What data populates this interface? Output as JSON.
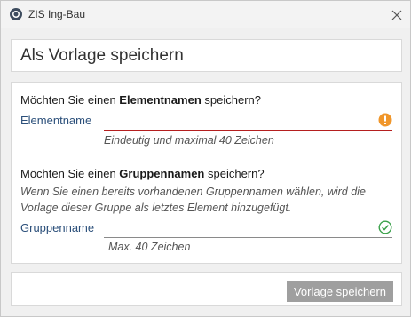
{
  "window": {
    "title": "ZIS Ing-Bau"
  },
  "dialog": {
    "title": "Als Vorlage speichern"
  },
  "element": {
    "question_prefix": "Möchten Sie einen ",
    "question_bold": "Elementnamen",
    "question_suffix": " speichern?",
    "label": "Elementname",
    "value": "",
    "hint": "Eindeutig und maximal 40 Zeichen",
    "status_icon": "warning-icon",
    "status_color": "#f0962a"
  },
  "group": {
    "question_prefix": "Möchten Sie einen ",
    "question_bold": "Gruppennamen",
    "question_suffix": " speichern?",
    "description": "Wenn Sie einen bereits vorhandenen Gruppennamen wählen, wird die Vorlage dieser Gruppe als letztes Element hinzugefügt.",
    "label": "Gruppenname",
    "value": "",
    "hint": "Max. 40 Zeichen",
    "status_icon": "check-circle-icon",
    "status_color": "#3aa14a"
  },
  "footer": {
    "save_label": "Vorlage speichern"
  }
}
